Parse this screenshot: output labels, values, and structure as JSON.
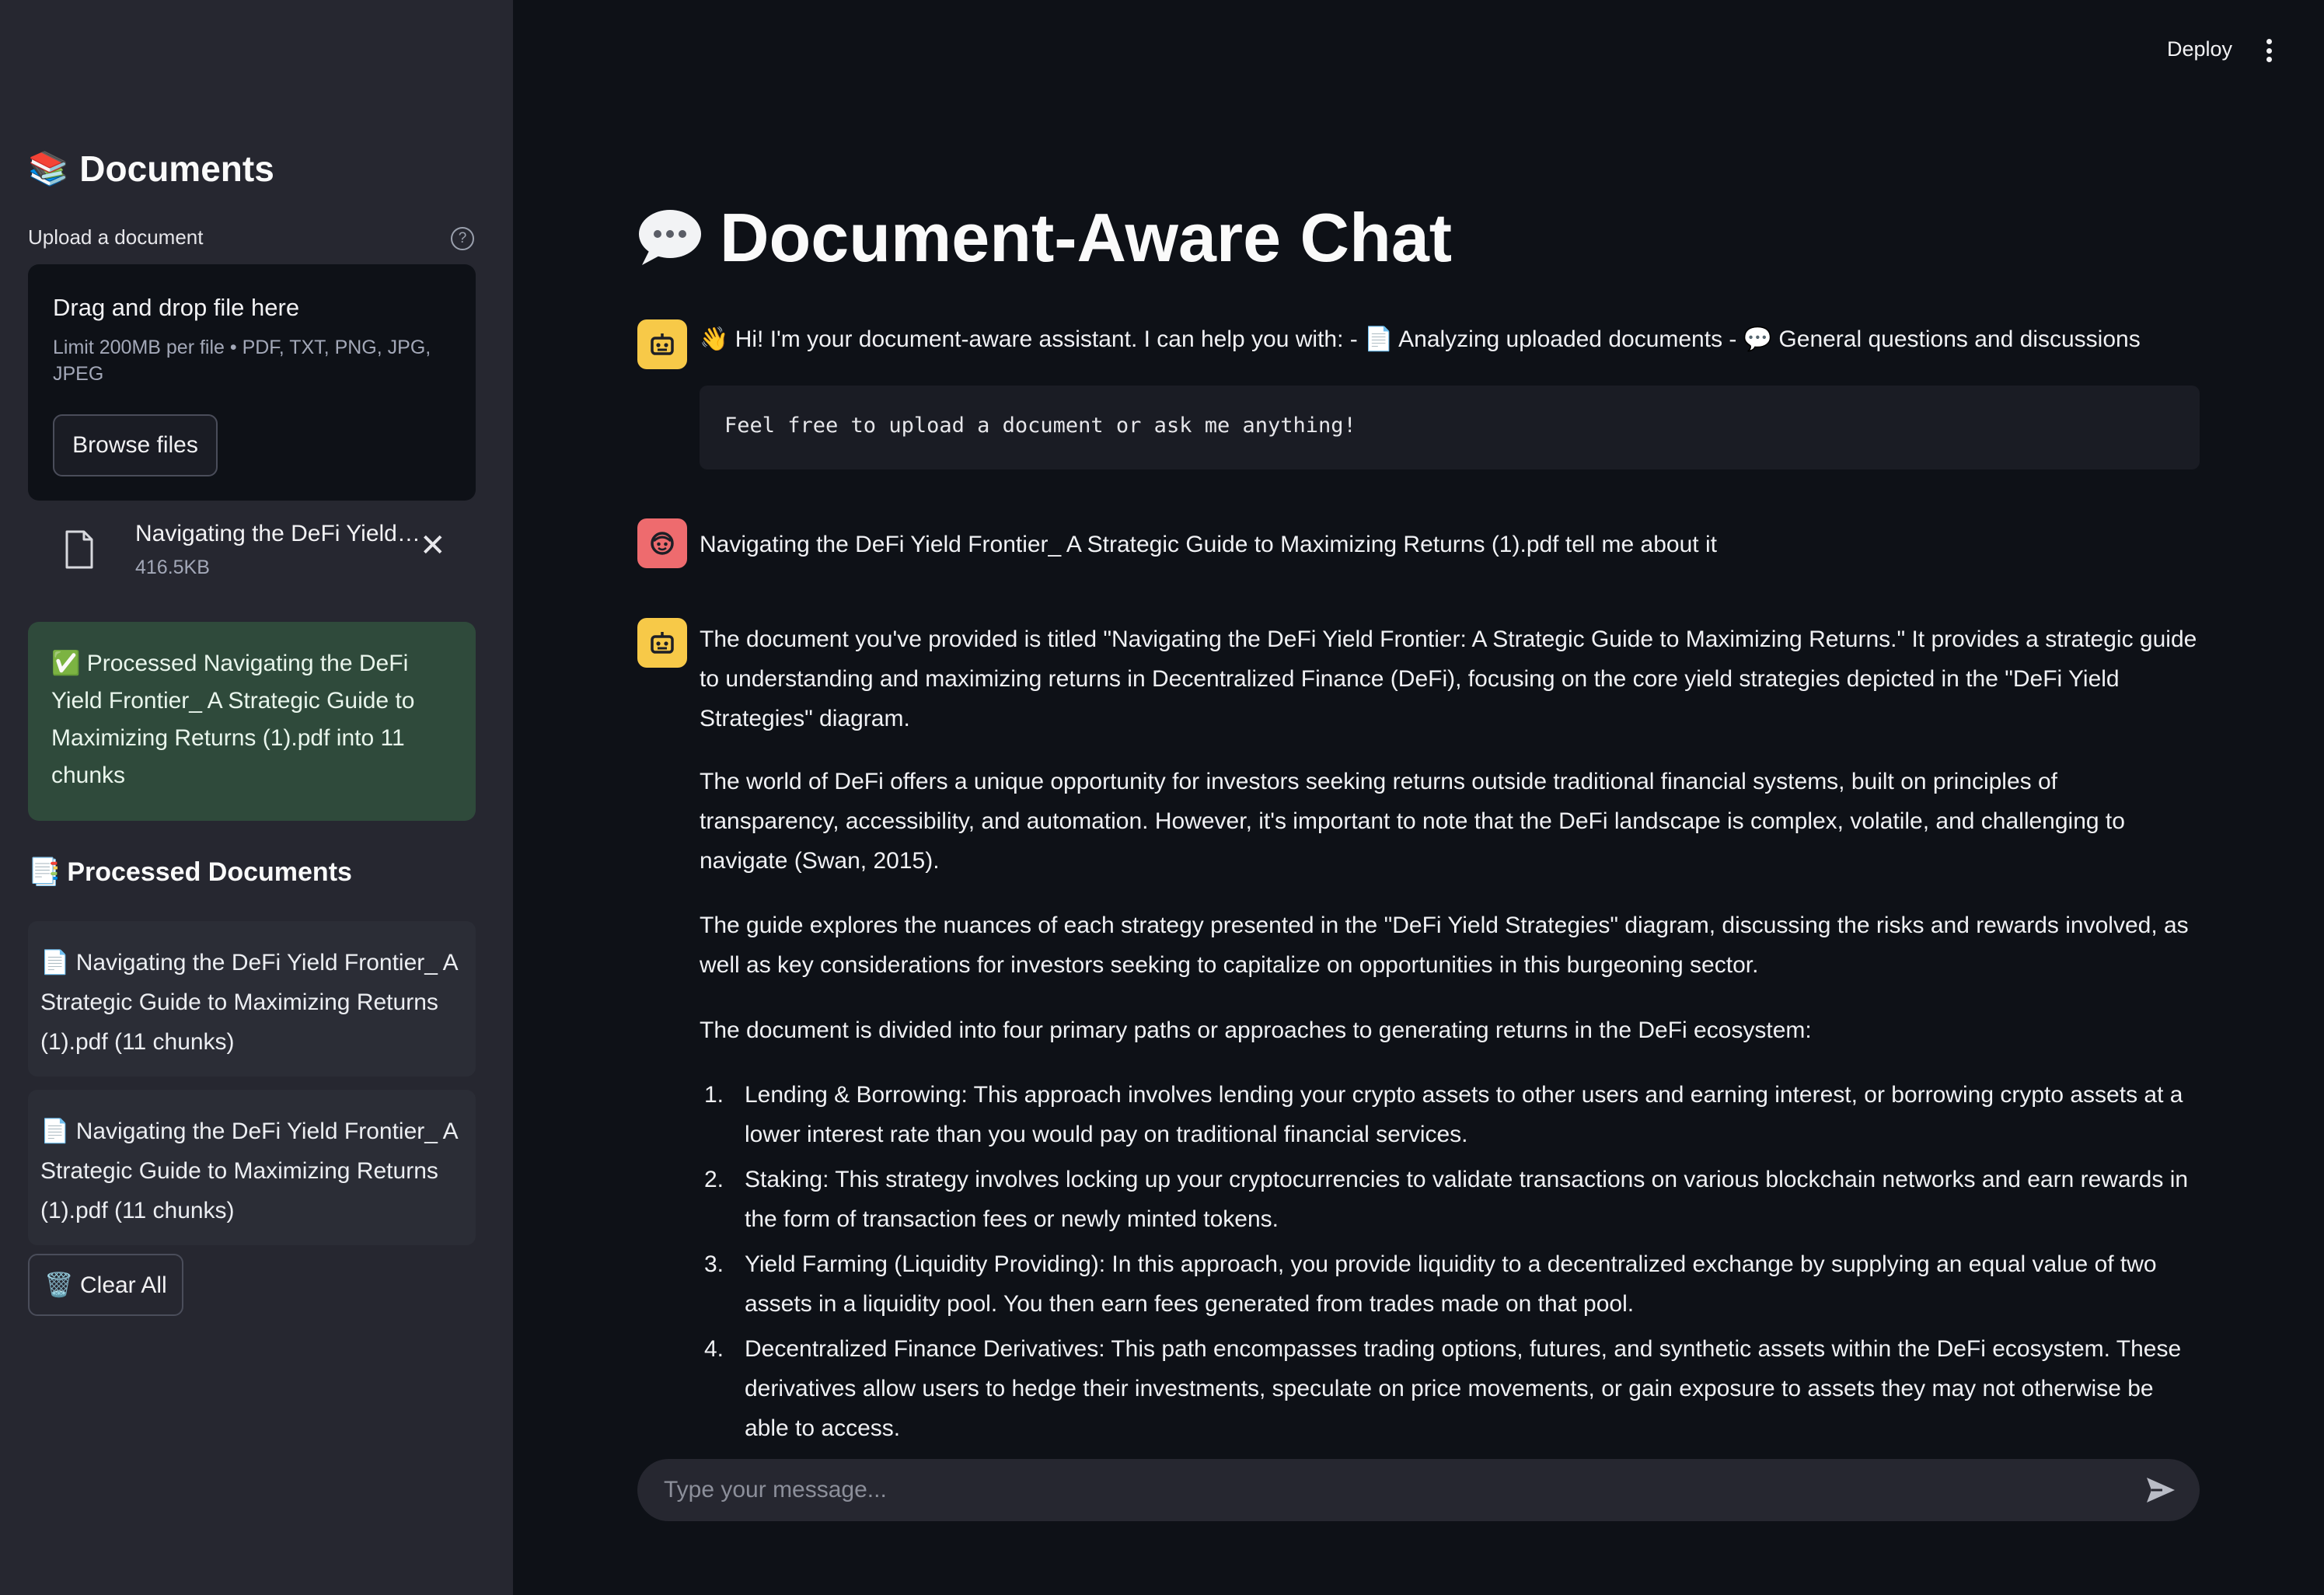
{
  "sidebar": {
    "title": "Documents",
    "title_emoji": "📚",
    "upload_label": "Upload a document",
    "dropzone": {
      "title": "Drag and drop file here",
      "limit": "Limit 200MB per file • PDF, TXT, PNG, JPG, JPEG",
      "browse_label": "Browse files"
    },
    "uploaded_file": {
      "name": "Navigating the DeFi Yield…",
      "size": "416.5KB"
    },
    "success_message": "✅ Processed Navigating the DeFi Yield Frontier_ A Strategic Guide to Maximizing Returns (1).pdf into 11 chunks",
    "processed_title": "Processed Documents",
    "processed_emoji": "📑",
    "processed_docs": [
      "📄 Navigating the DeFi Yield Frontier_ A Strategic Guide to Maximizing Returns (1).pdf (11 chunks)",
      "📄 Navigating the DeFi Yield Frontier_ A Strategic Guide to Maximizing Returns (1).pdf (11 chunks)"
    ],
    "clear_label": "🗑️ Clear All"
  },
  "header": {
    "deploy_label": "Deploy"
  },
  "main": {
    "title": "Document-Aware Chat",
    "messages": [
      {
        "role": "assistant",
        "text": "👋 Hi! I'm your document-aware assistant. I can help you with: - 📄 Analyzing uploaded documents - 💬 General questions and discussions",
        "code": "Feel free to upload a document or ask me anything!"
      },
      {
        "role": "user",
        "text": "Navigating the DeFi Yield Frontier_ A Strategic Guide to Maximizing Returns (1).pdf tell me about it"
      },
      {
        "role": "assistant",
        "paragraphs": [
          "The document you've provided is titled \"Navigating the DeFi Yield Frontier: A Strategic Guide to Maximizing Returns.\" It provides a strategic guide to understanding and maximizing returns in Decentralized Finance (DeFi), focusing on the core yield strategies depicted in the \"DeFi Yield Strategies\" diagram.",
          "The world of DeFi offers a unique opportunity for investors seeking returns outside traditional financial systems, built on principles of transparency, accessibility, and automation. However, it's important to note that the DeFi landscape is complex, volatile, and challenging to navigate (Swan, 2015).",
          "The guide explores the nuances of each strategy presented in the \"DeFi Yield Strategies\" diagram, discussing the risks and rewards involved, as well as key considerations for investors seeking to capitalize on opportunities in this burgeoning sector.",
          "The document is divided into four primary paths or approaches to generating returns in the DeFi ecosystem:"
        ],
        "list": [
          "Lending & Borrowing: This approach involves lending your crypto assets to other users and earning interest, or borrowing crypto assets at a lower interest rate than you would pay on traditional financial services.",
          "Staking: This strategy involves locking up your cryptocurrencies to validate transactions on various blockchain networks and earn rewards in the form of transaction fees or newly minted tokens.",
          "Yield Farming (Liquidity Providing): In this approach, you provide liquidity to a decentralized exchange by supplying an equal value of two assets in a liquidity pool. You then earn fees generated from trades made on that pool.",
          "Decentralized Finance Derivatives: This path encompasses trading options, futures, and synthetic assets within the DeFi ecosystem. These derivatives allow users to hedge their investments, speculate on price movements, or gain exposure to assets they may not otherwise be able to access."
        ],
        "list_numbers": [
          "1.",
          "2.",
          "3.",
          "4."
        ]
      }
    ],
    "chat_input": {
      "placeholder": "Type your message...",
      "value": ""
    }
  }
}
